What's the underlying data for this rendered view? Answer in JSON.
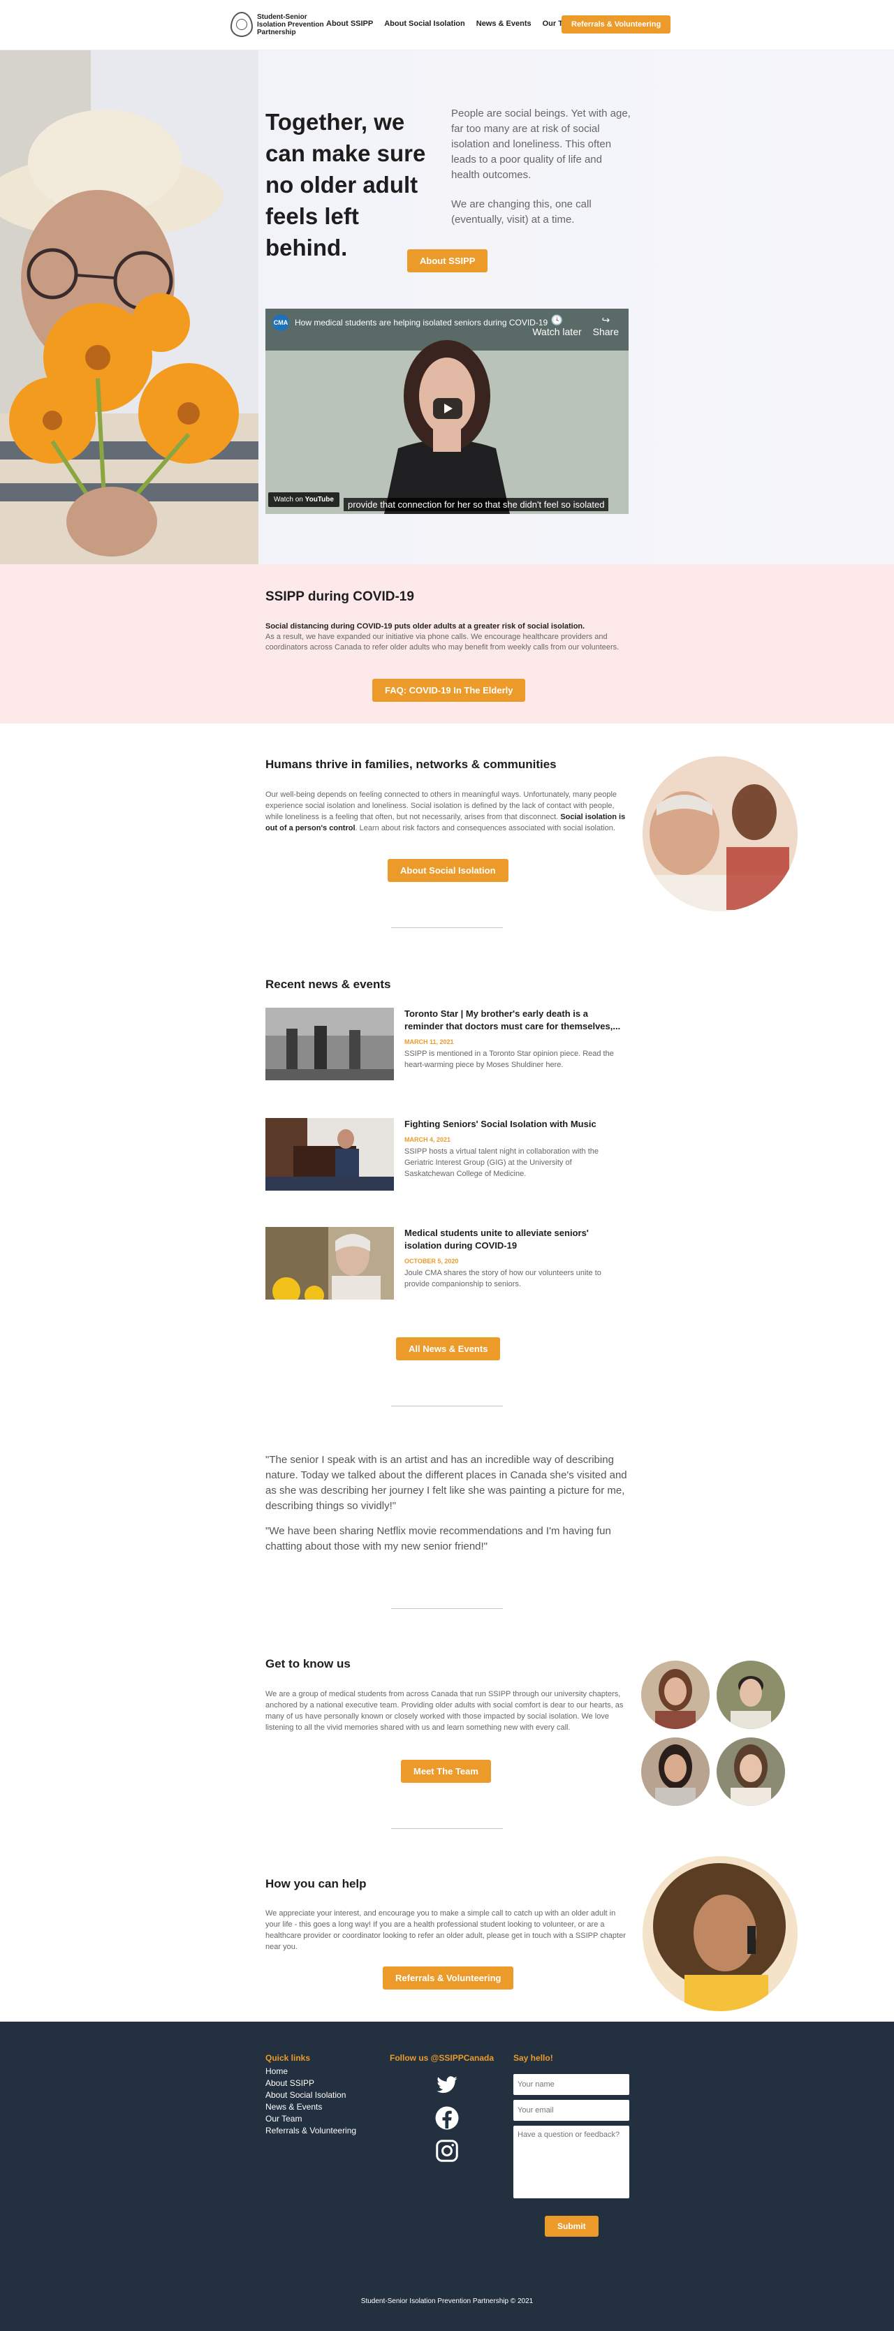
{
  "nav": {
    "logo_text": "Student-Senior Isolation Prevention Partnership",
    "links": [
      "About SSIPP",
      "About Social Isolation",
      "News & Events",
      "Our Team"
    ],
    "cta": "Referrals & Volunteering"
  },
  "hero": {
    "title": "Together, we can make sure no older adult feels left behind.",
    "para1": "People are social beings. Yet with age, far too many are at risk of social isolation and loneliness. This often leads to a poor quality of life and health outcomes.",
    "para2": "We are changing this, one call (eventually, visit) at a time.",
    "button": "About SSIPP",
    "video": {
      "channel_initials": "CMA",
      "title": "How medical students are helping isolated seniors during COVID-19",
      "watch_later": "Watch later",
      "share": "Share",
      "caption": "provide that connection for her so that she didn't feel so isolated",
      "watch_on": "Watch on",
      "platform": "YouTube"
    }
  },
  "covid": {
    "title": "SSIPP during COVID-19",
    "bold": "Social distancing during COVID-19 puts older adults at a greater risk of social isolation.",
    "body": "As a result, we have expanded our initiative via phone calls. We encourage healthcare providers and coordinators across Canada to refer older adults who may benefit from weekly calls from our volunteers.",
    "button": "FAQ: COVID-19 In The Elderly"
  },
  "humans": {
    "title": "Humans thrive in families, networks & communities",
    "body1": "Our well-being depends on feeling connected to others in meaningful ways. Unfortunately, many people experience social isolation and loneliness. Social isolation is defined by the lack of contact with people, while loneliness is a feeling that often, but not necessarily, arises from that disconnect.",
    "bold": "Social isolation is out of a person's control",
    "body2": ". Learn about risk factors and consequences associated with social isolation.",
    "button": "About Social Isolation"
  },
  "news": {
    "title": "Recent news & events",
    "items": [
      {
        "title": "Toronto Star | My brother's early death is a reminder that doctors must care for themselves,...",
        "date": "MARCH 11, 2021",
        "desc": "SSIPP is mentioned in a Toronto Star opinion piece. Read the heart-warming piece by Moses Shuldiner here."
      },
      {
        "title": "Fighting Seniors' Social Isolation with Music",
        "date": "MARCH 4, 2021",
        "desc": "SSIPP hosts a virtual talent night in collaboration with the Geriatric Interest Group (GIG) at the University of Saskatchewan College of Medicine."
      },
      {
        "title": "Medical students unite to alleviate seniors' isolation during COVID-19",
        "date": "OCTOBER 5, 2020",
        "desc": "Joule CMA shares the story of how our volunteers unite to provide companionship to seniors."
      }
    ],
    "button": "All News & Events"
  },
  "quotes": {
    "q1": "\"The senior I speak with is an artist and has an incredible way of describing nature. Today we talked about the different places in Canada she's visited and as she was describing her journey I felt like she was painting a picture for me, describing things so vividly!\"",
    "q2": "\"We have been sharing Netflix movie recommendations and I'm having fun chatting about those with my new senior friend!\""
  },
  "know": {
    "title": "Get to know us",
    "body": "We are a group of medical students from across Canada that run SSIPP through our university chapters, anchored by a national executive team. Providing older adults with social comfort is dear to our hearts, as many of us have personally known or closely worked with those impacted by social isolation. We love listening to all the vivid memories shared with us and learn something new with every call.",
    "button": "Meet The Team"
  },
  "help": {
    "title": "How you can help",
    "body": "We appreciate your interest, and encourage you to make a simple call to catch up with an older adult in your life - this goes a long way! If you are a health professional student looking to volunteer, or are a healthcare provider or coordinator looking to refer an older adult, please get in touch with a SSIPP chapter near you.",
    "button": "Referrals & Volunteering"
  },
  "footer": {
    "quick_links_title": "Quick links",
    "quick_links": [
      "Home",
      "About SSIPP",
      "About Social Isolation",
      "News & Events",
      "Our Team",
      "Referrals & Volunteering"
    ],
    "follow_title": "Follow us @SSIPPCanada",
    "social_icons": [
      "twitter-icon",
      "facebook-icon",
      "instagram-icon"
    ],
    "say_hello_title": "Say hello!",
    "name_placeholder": "Your name",
    "email_placeholder": "Your email",
    "question_placeholder": "Have a question or feedback?",
    "submit": "Submit",
    "copyright": "Student-Senior Isolation Prevention Partnership © 2021"
  },
  "colors": {
    "accent": "#ec9a2a",
    "covid_bg": "#fde9e9",
    "footer_bg": "#22303f"
  }
}
